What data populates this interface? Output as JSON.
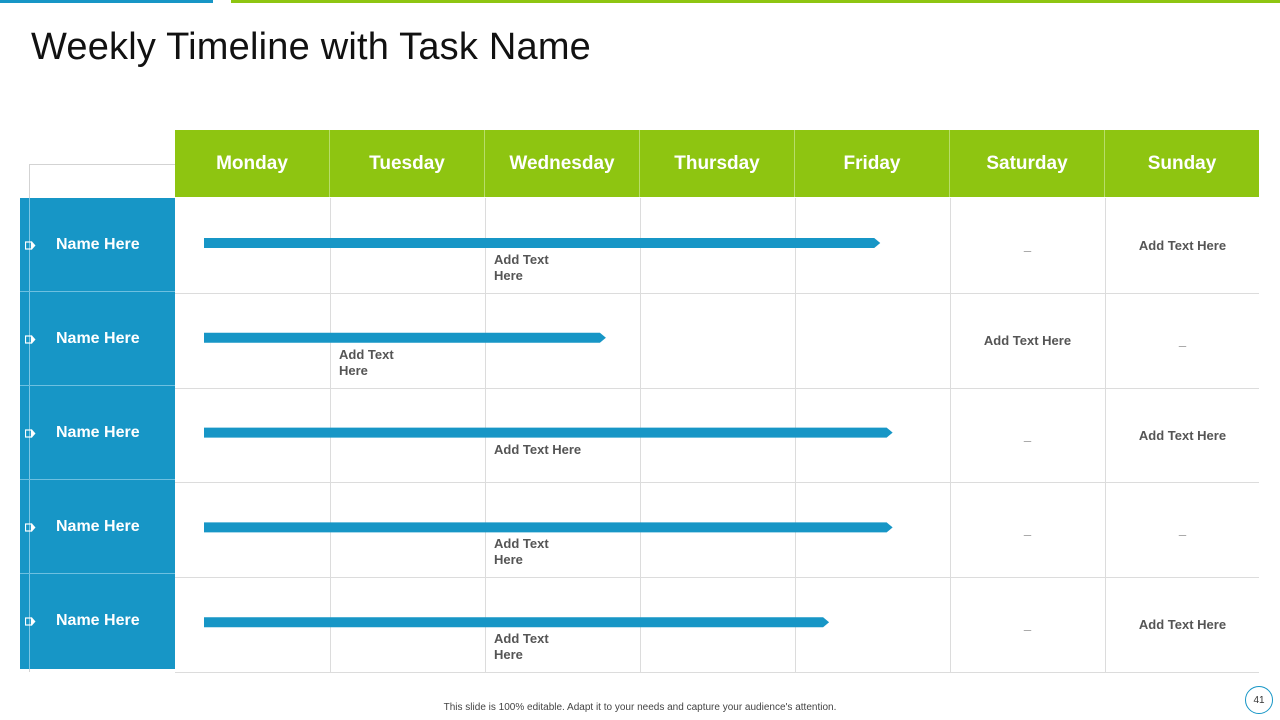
{
  "title": "Weekly Timeline with Task Name",
  "days": [
    "Monday",
    "Tuesday",
    "Wednesday",
    "Thursday",
    "Friday",
    "Saturday",
    "Sunday"
  ],
  "rows": [
    {
      "name": "Name Here",
      "bar_end_day": 4.55,
      "bar_note": "Add Text Here",
      "bar_note_col": 2,
      "bar_note_wrap": true,
      "saturday": "_",
      "sunday": "Add Text Here"
    },
    {
      "name": "Name Here",
      "bar_end_day": 2.78,
      "bar_note": "Add Text Here",
      "bar_note_col": 1,
      "bar_note_wrap": true,
      "saturday": "Add Text Here",
      "sunday": "_"
    },
    {
      "name": "Name Here",
      "bar_end_day": 4.63,
      "bar_note": "Add Text Here",
      "bar_note_col": 2,
      "bar_note_wrap": false,
      "saturday": "_",
      "sunday": "Add Text Here"
    },
    {
      "name": "Name Here",
      "bar_end_day": 4.63,
      "bar_note": "Add Text Here",
      "bar_note_col": 2,
      "bar_note_wrap": true,
      "saturday": "_",
      "sunday": "_"
    },
    {
      "name": "Name Here",
      "bar_end_day": 4.22,
      "bar_note": "Add Text Here",
      "bar_note_col": 2,
      "bar_note_wrap": true,
      "saturday": "_",
      "sunday": "Add Text Here"
    }
  ],
  "footer": "This slide is 100% editable. Adapt it to your needs and capture your audience's attention.",
  "page_number": "41",
  "colors": {
    "green": "#8ec511",
    "blue": "#1796c6"
  }
}
